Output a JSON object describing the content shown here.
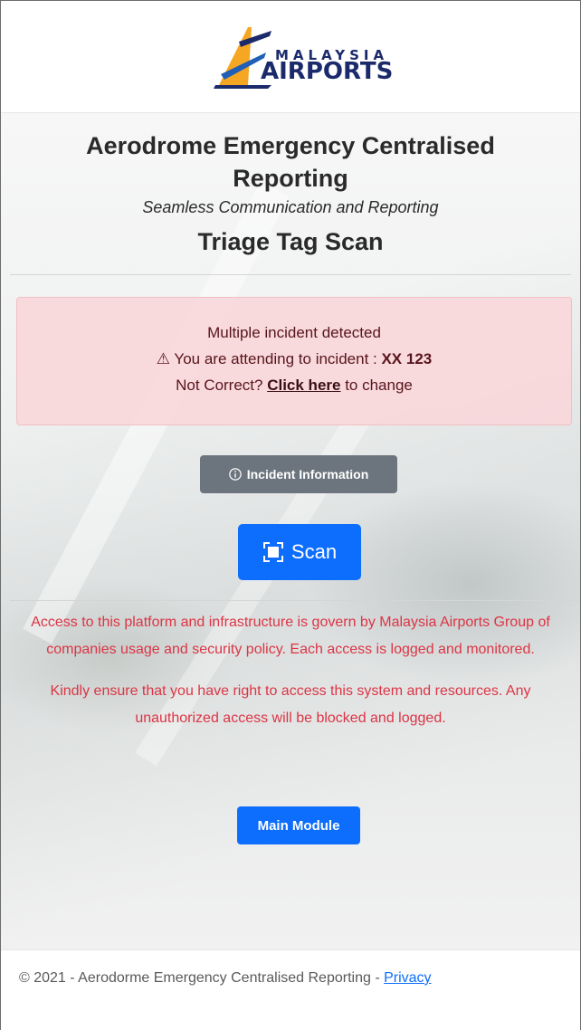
{
  "logo": {
    "text_top": "MALAYSIA",
    "text_bottom": "AIRPORTS"
  },
  "header": {
    "title": "Aerodrome Emergency Centralised Reporting",
    "subtitle": "Seamless Communication and Reporting",
    "page_name": "Triage Tag Scan"
  },
  "alert": {
    "line1": "Multiple incident detected",
    "line2_prefix": "You are attending to incident : ",
    "incident_id": "XX 123",
    "line3_prefix": "Not Correct? ",
    "link_label": "Click here",
    "line3_suffix": " to change",
    "icon": "warning-triangle-icon"
  },
  "buttons": {
    "incident_info_label": "Incident Information",
    "scan_label": "Scan",
    "main_module_label": "Main Module"
  },
  "notice": {
    "paragraph1": "Access to this platform and infrastructure is govern by Malaysia Airports Group of companies usage and security policy. Each access is logged and monitored.",
    "paragraph2": "Kindly ensure that you have right to access this system and resources. Any unauthorized access will be blocked and logged."
  },
  "footer": {
    "text": "© 2021 - Aerodorme Emergency Centralised Reporting - ",
    "privacy_label": "Privacy"
  },
  "colors": {
    "primary": "#0d6efd",
    "secondary": "#6c757d",
    "danger_text": "#dc3545",
    "alert_bg": "#f8d7da",
    "logo_navy": "#1b2a6b"
  }
}
